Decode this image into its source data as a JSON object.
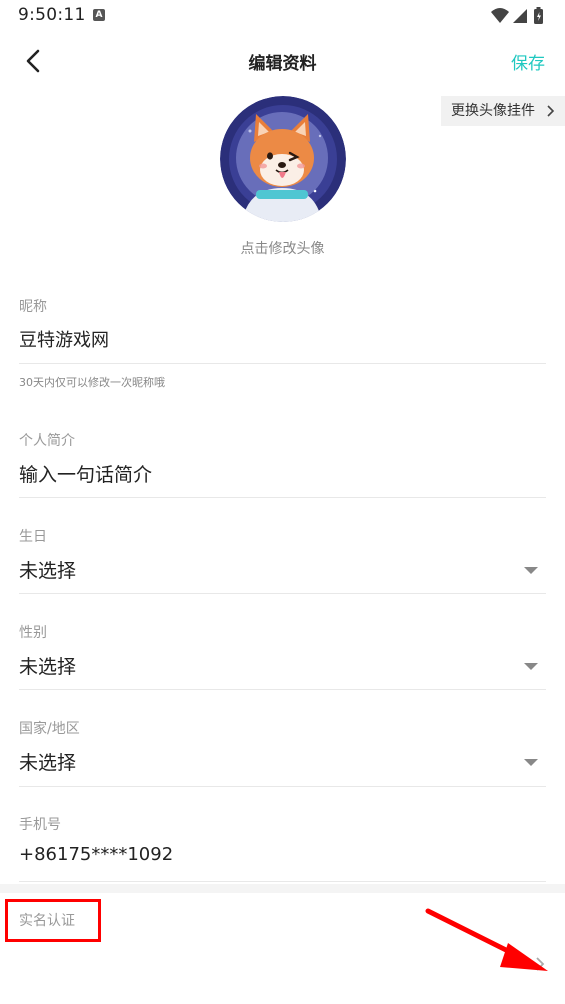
{
  "status_bar": {
    "time": "9:50:11",
    "notification_letter": "A"
  },
  "header": {
    "title": "编辑资料",
    "save_label": "保存"
  },
  "avatar": {
    "pendant_button_label": "更换头像挂件",
    "hint": "点击修改头像"
  },
  "fields": {
    "nickname": {
      "label": "昵称",
      "value": "豆特游戏网",
      "note": "30天内仅可以修改一次昵称哦"
    },
    "bio": {
      "label": "个人简介",
      "placeholder": "输入一句话简介"
    },
    "birthday": {
      "label": "生日",
      "value": "未选择"
    },
    "gender": {
      "label": "性别",
      "value": "未选择"
    },
    "region": {
      "label": "国家/地区",
      "value": "未选择"
    },
    "phone": {
      "label": "手机号",
      "value": "+86175****1092"
    },
    "realname": {
      "label": "实名认证"
    }
  },
  "colors": {
    "accent": "#1fc8c0",
    "annotation": "#ff0000"
  },
  "icons": [
    "back-arrow-icon",
    "chevron-right-icon",
    "dropdown-triangle-icon",
    "wifi-icon",
    "signal-icon",
    "battery-icon"
  ]
}
